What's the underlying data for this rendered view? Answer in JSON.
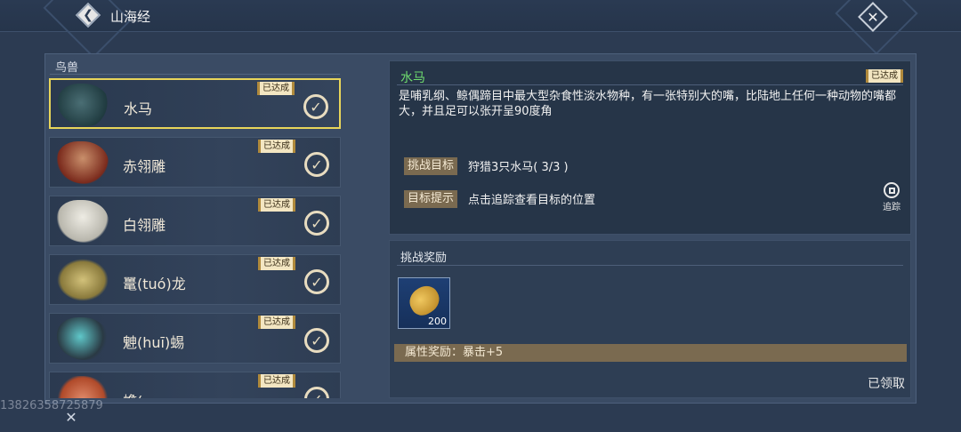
{
  "header": {
    "title": "山海经",
    "back_icon": "chevron-left-icon",
    "close_icon": "close-icon"
  },
  "category": {
    "label": "鸟兽"
  },
  "list": {
    "items": [
      {
        "name": "水马",
        "badge": "已达成",
        "status": "completed",
        "selected": true,
        "colors": [
          "#1f3a3f",
          "#4a6e74"
        ]
      },
      {
        "name": "赤翎雕",
        "badge": "已达成",
        "status": "completed",
        "selected": false,
        "colors": [
          "#7a2a1c",
          "#c98f6b"
        ]
      },
      {
        "name": "白翎雕",
        "badge": "已达成",
        "status": "completed",
        "selected": false,
        "colors": [
          "#d8d6cc",
          "#8a3a2a"
        ]
      },
      {
        "name": "鼍(tuó)龙",
        "badge": "已达成",
        "status": "completed",
        "selected": false,
        "colors": [
          "#8a7a3c",
          "#d2c17a"
        ]
      },
      {
        "name": "䰠(huī)蜴",
        "badge": "已达成",
        "status": "completed",
        "selected": false,
        "colors": [
          "#2a3a44",
          "#5fc7c9"
        ]
      },
      {
        "name": "蟾(",
        "badge": "已达成",
        "status": "completed",
        "selected": false,
        "colors": [
          "#b04a2a",
          "#e08a6a"
        ]
      }
    ]
  },
  "detail": {
    "name": "水马",
    "badge": "已达成",
    "description": "是哺乳纲、鲸偶蹄目中最大型杂食性淡水物种，有一张特别大的嘴，比陆地上任何一种动物的嘴都大，并且足可以张开呈90度角",
    "goal_label": "挑战目标",
    "goal_value": "狩猎3只水马( 3/3 )",
    "hint_label": "目标提示",
    "hint_value": "点击追踪查看目标的位置",
    "track_label": "追踪",
    "track_icon": "track-pin-icon"
  },
  "reward": {
    "title": "挑战奖励",
    "item_icon": "shell-icon",
    "item_qty": "200",
    "attr": "属性奖励：暴击+5",
    "claimed": "已领取"
  },
  "footer": {
    "watermark": "13826358725879",
    "close_icon": "close-icon"
  },
  "colors": {
    "accent_green": "#6fdc6f",
    "selected_border": "#e8d55a",
    "tag_bg": "#7a6a50"
  }
}
